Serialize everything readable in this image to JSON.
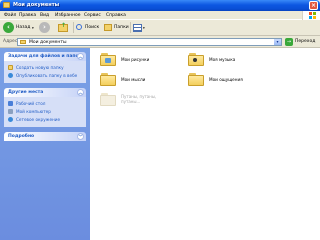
{
  "window": {
    "title": "Мои документы"
  },
  "menu": [
    "Файл",
    "Правка",
    "Вид",
    "Избранное",
    "Сервис",
    "Справка"
  ],
  "toolbar": {
    "back_label": "Назад",
    "search_label": "Поиск",
    "folders_label": "Папки"
  },
  "address": {
    "label": "Адрес:",
    "value": "Мои документы",
    "go_label": "Переход"
  },
  "tasks_panel": {
    "title": "Задачи для файлов и папок",
    "items": [
      "Создать новую папку",
      "Опубликовать папку в вебе"
    ]
  },
  "places_panel": {
    "title": "Другие места",
    "items": [
      "Рабочий стол",
      "Мой компьютер",
      "Сетевое окружение"
    ]
  },
  "details_panel": {
    "title": "Подробно"
  },
  "folders": [
    {
      "name": "Мои рисунки",
      "icon": "pictures-folder-icon"
    },
    {
      "name": "Моя музыка",
      "icon": "music-folder-icon"
    },
    {
      "name": "Мои мысли",
      "icon": "folder-icon"
    },
    {
      "name": "Мои ощущения",
      "icon": "folder-icon"
    }
  ],
  "ghost_item": {
    "line1": "Путаны, путаны,",
    "line2": "путаны..."
  },
  "colors": {
    "title_bar": "#0d57e2",
    "left_pane": "#7aa1e6",
    "link_text": "#215dc6",
    "folder": "#f3cf5c"
  }
}
